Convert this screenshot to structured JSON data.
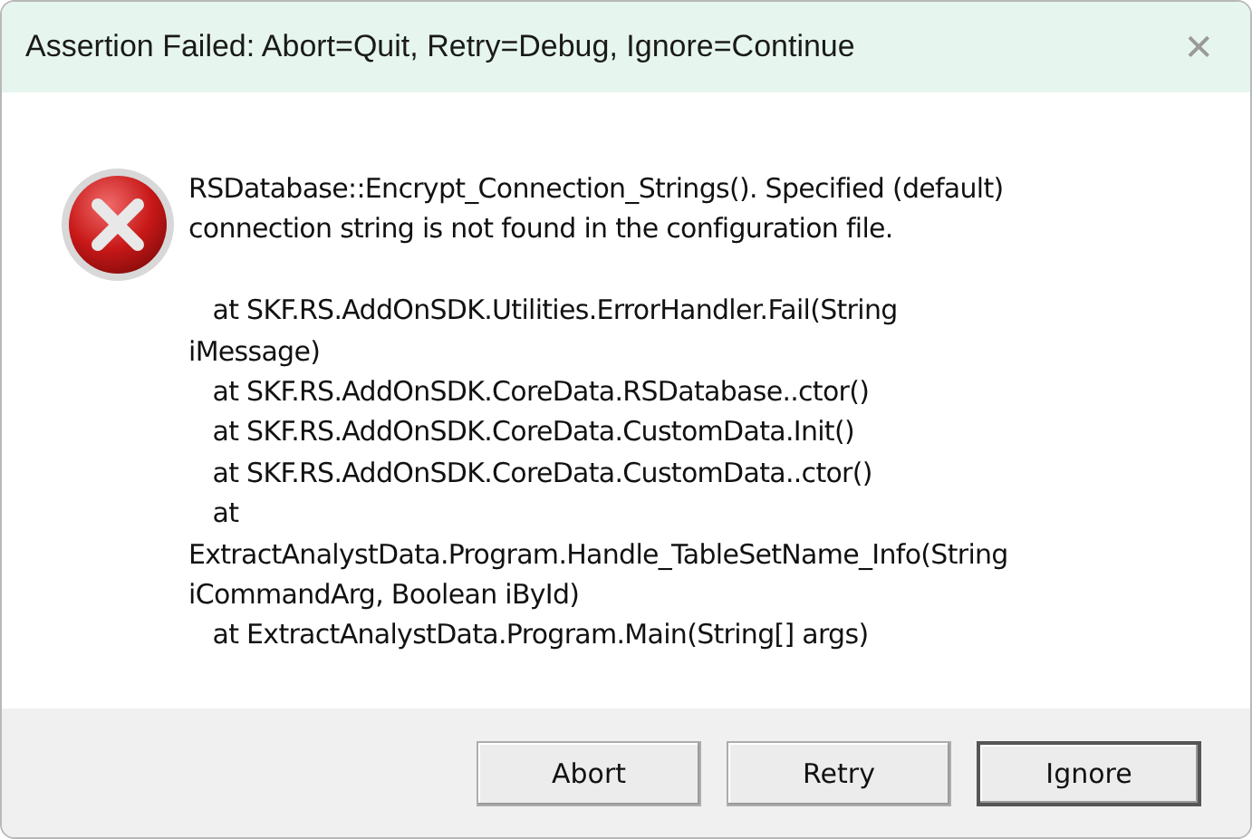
{
  "window": {
    "title": "Assertion Failed: Abort=Quit, Retry=Debug, Ignore=Continue",
    "close": "✕"
  },
  "message": {
    "lines": [
      "RSDatabase::Encrypt_Connection_Strings(). Specified (default)",
      "connection string is not found in the configuration file."
    ]
  },
  "stack_trace": {
    "lines": [
      "   at SKF.RS.AddOnSDK.Utilities.ErrorHandler.Fail(String",
      "iMessage)",
      "   at SKF.RS.AddOnSDK.CoreData.RSDatabase..ctor()",
      "   at SKF.RS.AddOnSDK.CoreData.CustomData.Init()",
      "   at SKF.RS.AddOnSDK.CoreData.CustomData..ctor()",
      "   at",
      "ExtractAnalystData.Program.Handle_TableSetName_Info(String",
      "iCommandArg, Boolean iById)",
      "   at ExtractAnalystData.Program.Main(String[] args)"
    ]
  },
  "buttons": [
    {
      "label": "Abort",
      "default": false
    },
    {
      "label": "Retry",
      "default": false
    },
    {
      "label": "Ignore",
      "default": true
    }
  ]
}
